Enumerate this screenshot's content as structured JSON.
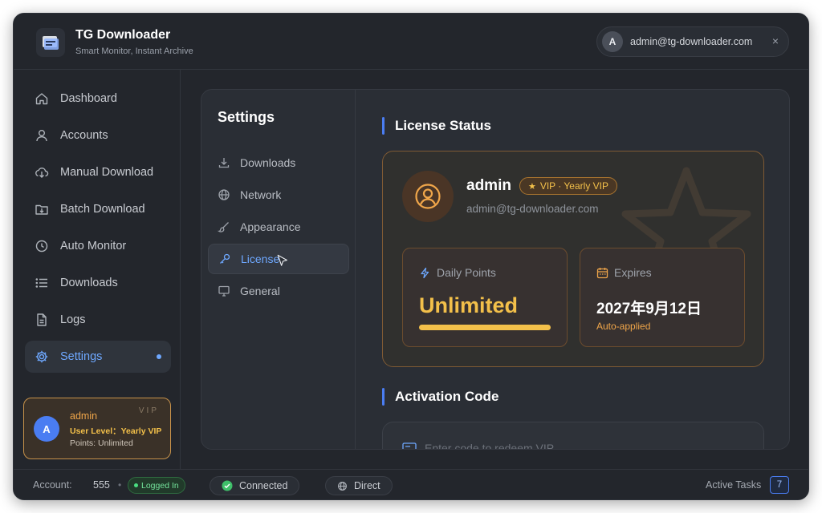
{
  "app": {
    "title": "TG Downloader",
    "subtitle": "Smart Monitor, Instant Archive"
  },
  "header": {
    "user_initial": "A",
    "user_email": "admin@tg-downloader.com",
    "close_label": "×"
  },
  "sidebar": {
    "items": [
      {
        "label": "Dashboard",
        "icon": "home-icon"
      },
      {
        "label": "Accounts",
        "icon": "user-icon"
      },
      {
        "label": "Manual Download",
        "icon": "cloud-download-icon"
      },
      {
        "label": "Batch Download",
        "icon": "folder-download-icon"
      },
      {
        "label": "Auto Monitor",
        "icon": "clock-icon"
      },
      {
        "label": "Downloads",
        "icon": "list-icon"
      },
      {
        "label": "Logs",
        "icon": "document-icon"
      },
      {
        "label": "Settings",
        "icon": "gear-icon",
        "active": true
      }
    ],
    "vip_card": {
      "initial": "A",
      "name": "admin",
      "tag": "VIP",
      "level": "User Level：Yearly VIP",
      "points": "Points: Unlimited"
    }
  },
  "settings": {
    "title": "Settings",
    "nav": [
      {
        "label": "Downloads",
        "icon": "download-icon"
      },
      {
        "label": "Network",
        "icon": "globe-icon"
      },
      {
        "label": "Appearance",
        "icon": "brush-icon"
      },
      {
        "label": "License",
        "icon": "key-icon",
        "active": true
      },
      {
        "label": "General",
        "icon": "monitor-icon"
      }
    ]
  },
  "license": {
    "heading": "License Status",
    "username": "admin",
    "badge": "VIP · Yearly VIP",
    "email": "admin@tg-downloader.com",
    "daily_points_label": "Daily Points",
    "daily_points_value": "Unlimited",
    "expires_label": "Expires",
    "expires_value": "2027年9月12日",
    "expires_note": "Auto-applied"
  },
  "activation": {
    "heading": "Activation Code",
    "placeholder": "Enter code to redeem VIP"
  },
  "footer": {
    "account_label": "Account:",
    "account_value": "555",
    "separator": "•",
    "logged_in": "Logged In",
    "connection": "Connected",
    "proxy": "Direct",
    "active_tasks_label": "Active Tasks",
    "active_tasks_count": "7"
  },
  "colors": {
    "accent": "#4a7df2",
    "active_text": "#6ea8ff",
    "gold": "#f3c04a",
    "success": "#4ade80"
  }
}
